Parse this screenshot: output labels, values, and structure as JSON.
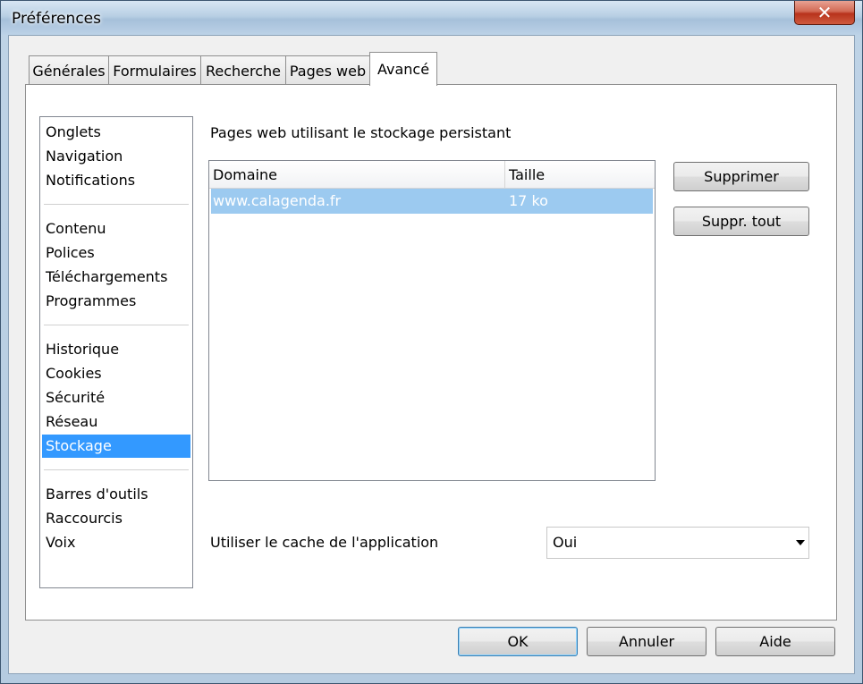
{
  "window": {
    "title": "Préférences",
    "close_label": "✕"
  },
  "tabs": [
    {
      "label": "Générales"
    },
    {
      "label": "Formulaires"
    },
    {
      "label": "Recherche"
    },
    {
      "label": "Pages web"
    },
    {
      "label": "Avancé",
      "active": true
    }
  ],
  "categories": {
    "group1": [
      "Onglets",
      "Navigation",
      "Notifications"
    ],
    "group2": [
      "Contenu",
      "Polices",
      "Téléchargements",
      "Programmes"
    ],
    "group3": [
      "Historique",
      "Cookies",
      "Sécurité",
      "Réseau",
      "Stockage"
    ],
    "group4": [
      "Barres d'outils",
      "Raccourcis",
      "Voix"
    ],
    "selected": "Stockage"
  },
  "storage": {
    "section_label": "Pages web utilisant le stockage persistant",
    "columns": [
      "Domaine",
      "Taille"
    ],
    "rows": [
      {
        "domain": "www.calagenda.fr",
        "size": "17 ko"
      }
    ],
    "delete_label": "Supprimer",
    "delete_all_label": "Suppr. tout"
  },
  "cache": {
    "label": "Utiliser le cache de l'application",
    "value": "Oui"
  },
  "footer": {
    "ok_label": "OK",
    "cancel_label": "Annuler",
    "help_label": "Aide"
  },
  "colors": {
    "selection": "#3399ff",
    "row_selection": "#9ccaf0",
    "close_button": "#c4412a"
  }
}
